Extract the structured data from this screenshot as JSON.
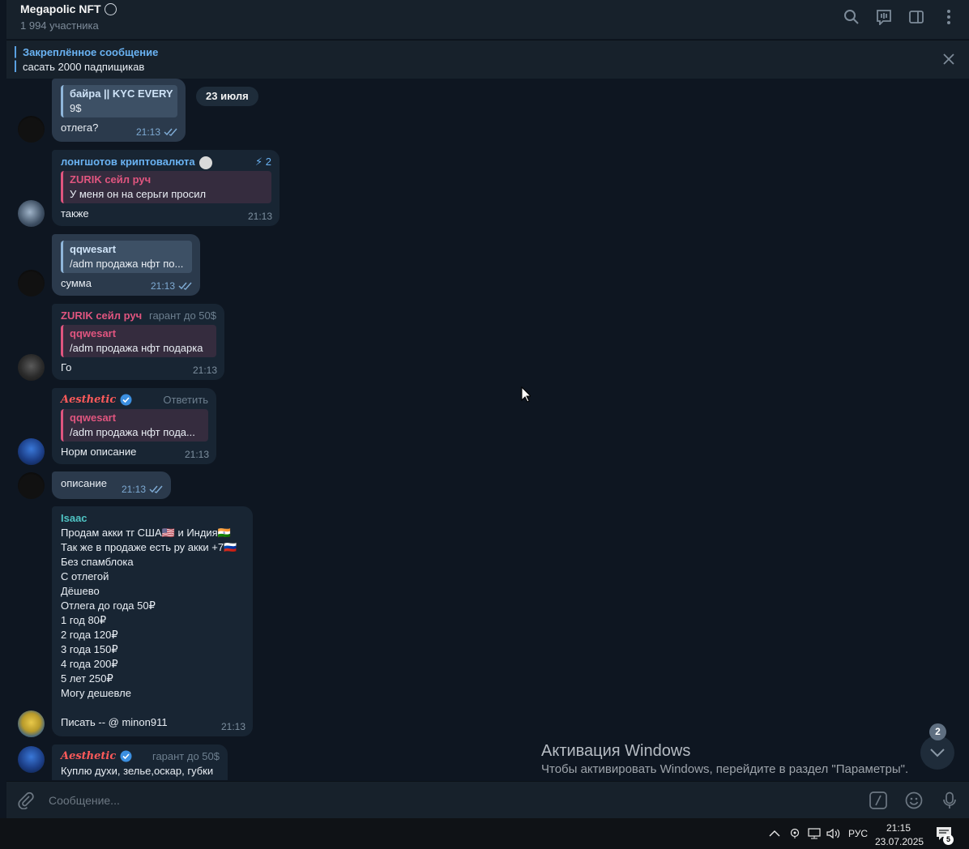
{
  "header": {
    "title": "Megapolic NFT",
    "subtitle": "1 994 участника",
    "icons": [
      "search-icon",
      "video-chat-icon",
      "sidebar-toggle-icon",
      "more-icon"
    ]
  },
  "pinned": {
    "title": "Закреплённое сообщение",
    "text": "сасать 2000 падпищикав"
  },
  "date_badge": "23 июля",
  "messages": [
    {
      "quote_author": "байра || KYC EVERY",
      "quote_text": "9$",
      "text": "отлега?",
      "time": "21:13",
      "read": true
    },
    {
      "sender": "лонгшотов криптовалюта",
      "tag": "2",
      "quote_author": "ZURIK сейл руч",
      "quote_text": "У меня он на серьги просил",
      "text": "также",
      "time": "21:13"
    },
    {
      "quote_author": "qqwesart",
      "quote_text": "/adm продажа нфт по...",
      "text": "сумма",
      "time": "21:13",
      "read": true
    },
    {
      "sender": "ZURIK сейл руч",
      "tag": "гарант до 50$",
      "quote_author": "qqwesart",
      "quote_text": "/adm продажа нфт подарка",
      "text": "Го",
      "time": "21:13"
    },
    {
      "sender": "Aesthetic",
      "tag": "Ответить",
      "quote_author": "qqwesart",
      "quote_text": "/adm продажа нфт пода...",
      "text": "Норм описание",
      "time": "21:13"
    },
    {
      "text": "описание",
      "time": "21:13",
      "read": true
    },
    {
      "sender": "Isaac",
      "lines": [
        "Продам акки тг США🇺🇸 и Индия🇮🇳",
        "Так же в продаже есть ру акки +7🇷🇺",
        "Без спамблока",
        "С отлегой",
        "Дёшево",
        "Отлега до года 50₽",
        "1 год 80₽",
        "2 года 120₽",
        "3 года 150₽",
        "4 года 200₽",
        "5 лет 250₽",
        "Могу дешевле",
        "",
        "Писать -- @ minon911"
      ],
      "time": "21:13"
    },
    {
      "sender": "Aesthetic",
      "tag": "гарант до 50$",
      "text": "Куплю духи, зелье,оскар, губки"
    }
  ],
  "activation": {
    "title": "Активация Windows",
    "text": "Чтобы активировать Windows, перейдите в раздел \"Параметры\"."
  },
  "scroll_badge": "2",
  "composer": {
    "placeholder": "Сообщение..."
  },
  "taskbar": {
    "lang": "РУС",
    "time": "21:15",
    "date": "23.07.2025",
    "notif_count": "5"
  },
  "colors": {
    "accent": "#6ab3f3",
    "pink": "#e0557f",
    "aesthetic": "#ff5a5a",
    "isaac": "#4fc3c3"
  }
}
